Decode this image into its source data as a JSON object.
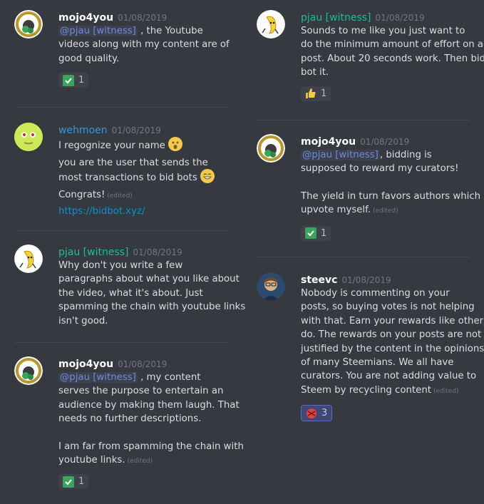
{
  "left": {
    "m1": {
      "author": "mojo4you",
      "time": "01/08/2019",
      "mention": "@pjau [witness]",
      "l1": " , the Youtube",
      "l2": "videos along with my content are of",
      "l3": "good quality.",
      "react_count": "1"
    },
    "m2": {
      "author": "wehmoen",
      "time": "01/08/2019",
      "l1": "I regognize your name",
      "l2": "you are the user that sends the",
      "l3": "most transactions to bid bots",
      "l4": "Congrats!",
      "edited": "(edited)",
      "link": "https://bidbot.xyz/"
    },
    "m3": {
      "author": "pjau [witness]",
      "time": "01/08/2019",
      "l1": "Why don't you write a few",
      "l2": "paragraphs about what you like about",
      "l3": "the video, what it's about. Just",
      "l4": "spamming the chain with youtube links",
      "l5": "isn't good."
    },
    "m4": {
      "author": "mojo4you",
      "time": "01/08/2019",
      "mention": "@pjau [witness]",
      "l1": " , my content",
      "l2": "serves the purpose to entertain an",
      "l3": "audience by making them laugh. That",
      "l4": "needs no further descriptions.",
      "l5": "I am far from spamming the chain with",
      "l6": "youtube links.",
      "edited": "(edited)",
      "react_count": "1"
    }
  },
  "right": {
    "m1": {
      "author": "pjau [witness]",
      "time": "01/08/2019",
      "l1": "Sounds to me like you just want to",
      "l2": "do the minimum amount of effort on a",
      "l3": "post. About 20 seconds work. Then bid",
      "l4": "bot it.",
      "react_count": "1"
    },
    "m2": {
      "author": "mojo4you",
      "time": "01/08/2019",
      "mention": "@pjau [witness]",
      "l1": ", bidding is",
      "l2": "supposed to reward my curators!",
      "l3": "The yield in turn favors authors which I",
      "l4": "upvote myself.",
      "edited": "(edited)",
      "react_count": "1"
    },
    "m3": {
      "author": "steevc",
      "time": "01/08/2019",
      "l1": "Nobody is commenting on your",
      "l2": "posts, so buying votes is not helping",
      "l3": "with that. Earn your rewards like others",
      "l4": "do. The rewards on your posts are not",
      "l5": "justified by the content in the opinions",
      "l6": "of many Steemians. We all have",
      "l7": "curators. You are not adding value to",
      "l8": "Steem by recycling content",
      "edited": "(edited)",
      "react_count": "3"
    }
  },
  "colors": {
    "background": "#36393f",
    "mention": "#7289da",
    "link": "#0096cf",
    "role_green": "#1abc9c",
    "role_blue": "#3498db"
  }
}
